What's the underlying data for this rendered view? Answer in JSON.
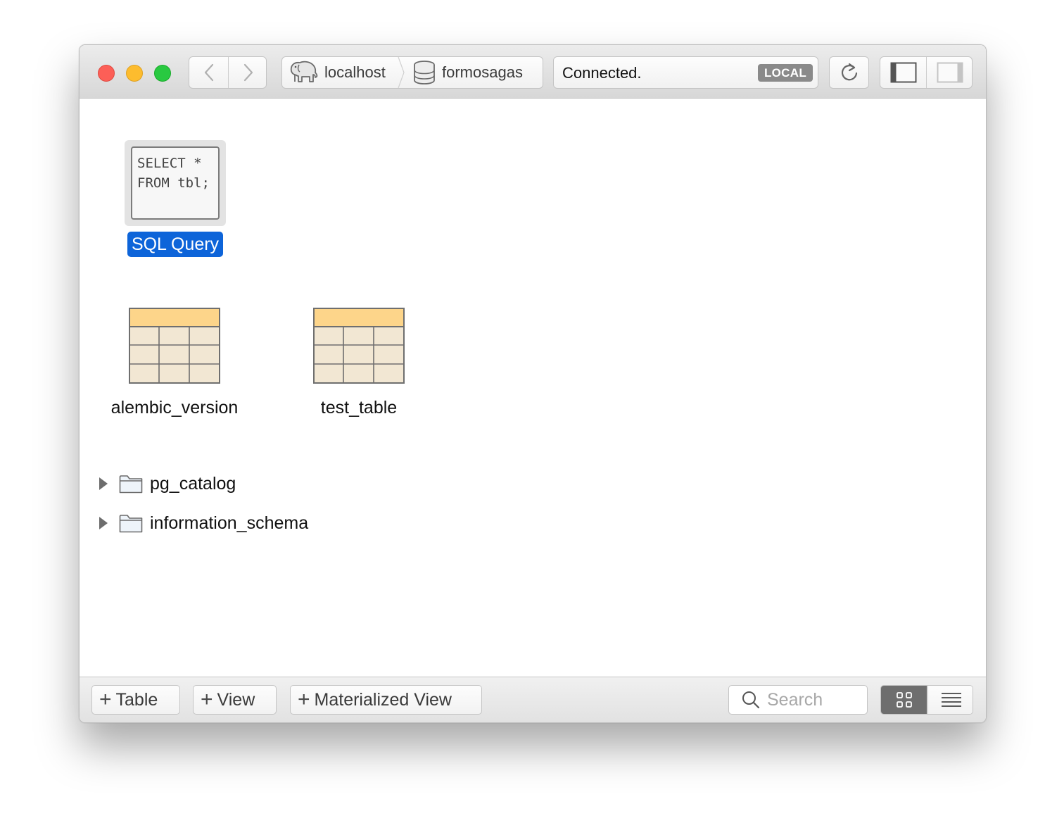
{
  "titlebar": {
    "breadcrumb": {
      "server": "localhost",
      "database": "formosagas"
    },
    "status": {
      "message": "Connected.",
      "badge": "LOCAL"
    }
  },
  "content": {
    "query_item": {
      "thumbnail_text": "SELECT *\nFROM tbl;",
      "label": "SQL Query"
    },
    "tables": [
      {
        "name": "alembic_version"
      },
      {
        "name": "test_table"
      }
    ],
    "schemas": [
      {
        "name": "pg_catalog"
      },
      {
        "name": "information_schema"
      }
    ]
  },
  "bottombar": {
    "add_table_label": "Table",
    "add_view_label": "View",
    "add_materialized_view_label": "Materialized View",
    "search_placeholder": "Search",
    "view_mode": "grid"
  },
  "colors": {
    "selection": "#0d64d9",
    "table_header": "#fdd58a",
    "table_body": "#f2e7d3",
    "badge": "#8a8a8a"
  }
}
